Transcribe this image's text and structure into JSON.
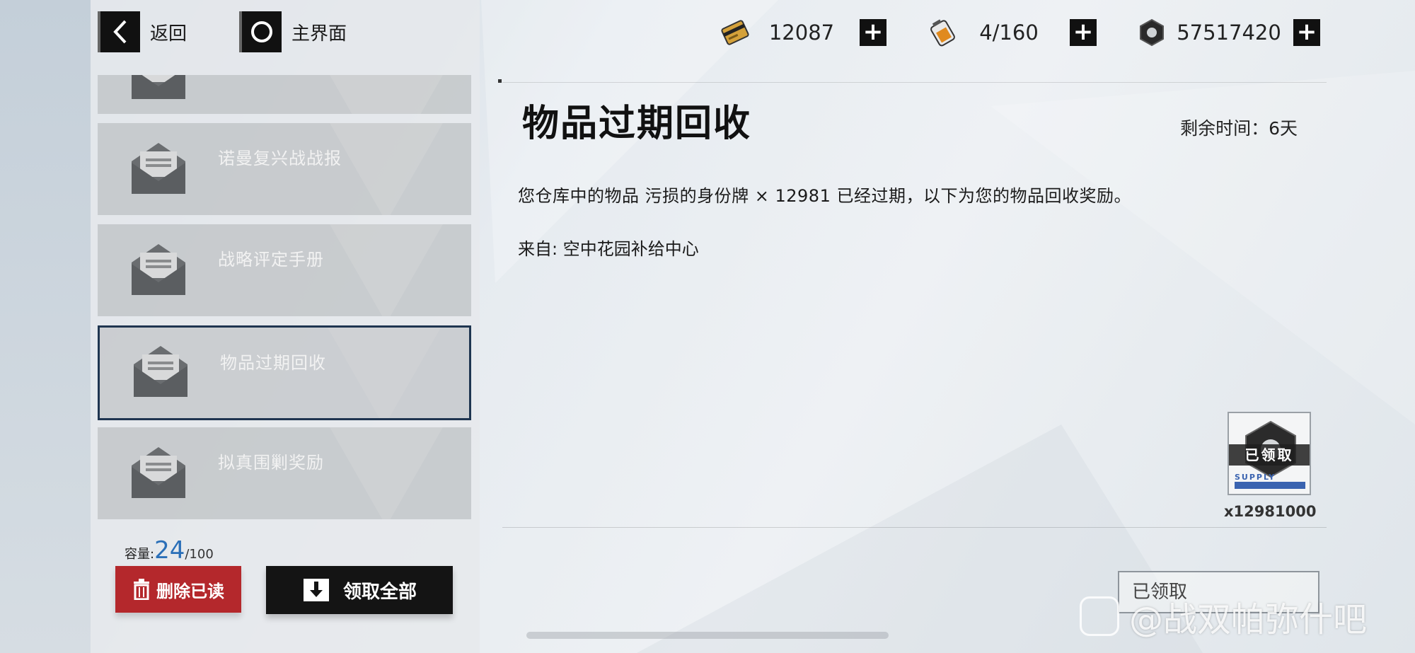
{
  "nav": {
    "back_label": "返回",
    "home_label": "主界面"
  },
  "currencies": [
    {
      "icon": "card-icon",
      "value": "12087"
    },
    {
      "icon": "battery-icon",
      "value": "4/160"
    },
    {
      "icon": "nut-icon",
      "value": "57517420"
    }
  ],
  "mail_list": {
    "items": [
      {
        "title": ""
      },
      {
        "title": "诺曼复兴战战报"
      },
      {
        "title": "战略评定手册"
      },
      {
        "title": "物品过期回收"
      },
      {
        "title": "拟真围剿奖励"
      }
    ],
    "selected_index": 3,
    "capacity_label": "容量:",
    "capacity_used": "24",
    "capacity_max": "/100",
    "delete_read_label": "删除已读",
    "claim_all_label": "领取全部"
  },
  "detail": {
    "title": "物品过期回收",
    "remaining_time": "剩余时间：6天",
    "body": "您仓库中的物品 污损的身份牌 × 12981 已经过期，以下为您的物品回收奖励。",
    "from": "来自: 空中花园补给中心",
    "reward": {
      "status_label": "已领取",
      "supply_label": "SUPPLY",
      "count": "x12981000"
    },
    "claimed_button_label": "已领取"
  },
  "watermark": {
    "text": "@战双帕弥什吧"
  },
  "colors": {
    "selected_border": "#1f3550",
    "delete_button": "#b4282c",
    "capacity_number": "#2a6fb8",
    "supply_blue": "#3a63b0"
  }
}
